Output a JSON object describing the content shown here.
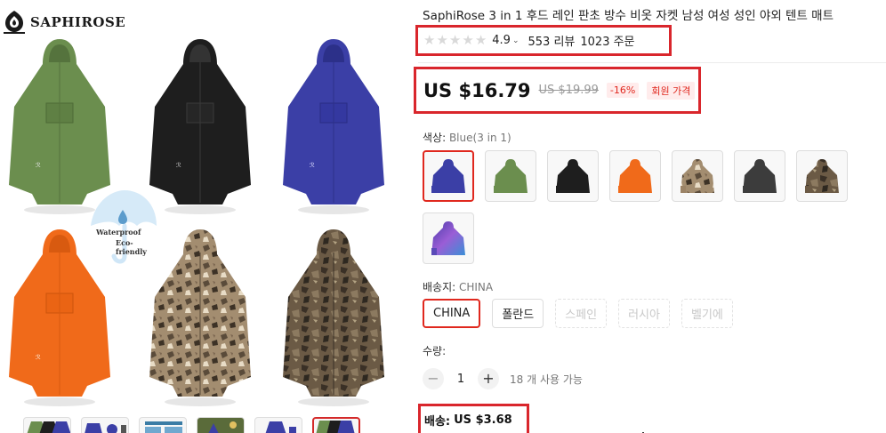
{
  "brand": {
    "name": "SAPHIROSE"
  },
  "watermark": {
    "line1": "Waterproof",
    "line2": "Eco-friendly"
  },
  "product": {
    "title": "SaphiRose 3 in 1 후드 레인 판초 방수 비옷 자켓 남성 여성 성인 야외 텐트 매트"
  },
  "rating": {
    "score": "4.9",
    "chevron": "⌄",
    "reviews": "553 리뷰",
    "orders": "1023 주문"
  },
  "price": {
    "current": "US $16.79",
    "original": "US $19.99",
    "discount": "-16%",
    "member_badge": "회원 가격"
  },
  "color": {
    "label": "색상: ",
    "selected": "Blue(3 in 1)",
    "options": [
      "Blue(3 in 1)",
      "Green",
      "Black",
      "Orange",
      "Camo",
      "Dark Grey",
      "Forest Camo",
      "Galaxy"
    ]
  },
  "ship_from": {
    "label": "배송지: ",
    "selected": "CHINA",
    "options": [
      "CHINA",
      "폴란드",
      "스페인",
      "러시아",
      "벨기에"
    ]
  },
  "quantity": {
    "label": "수량:",
    "minus": "−",
    "value": "1",
    "plus": "+",
    "available": "18 개 사용 가능"
  },
  "shipping": {
    "label": "배송:",
    "value": "US $3.68"
  },
  "colors": {
    "accent_red": "#d9262c",
    "green": "#6b8e4e",
    "black": "#1e1e1e",
    "blue": "#3b3fa6",
    "orange": "#f06a1a",
    "camo_light": "#9b8366",
    "camo_dark": "#5a4b3a"
  }
}
